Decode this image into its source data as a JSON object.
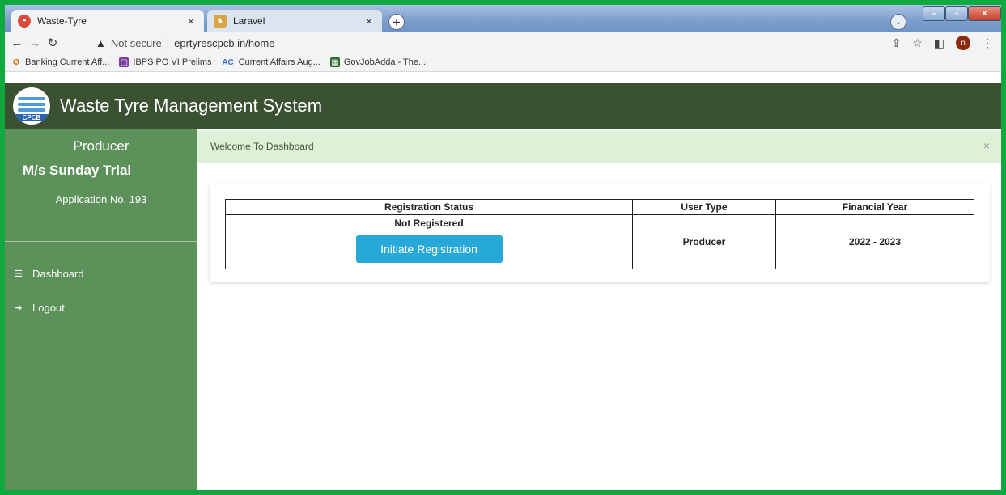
{
  "browser": {
    "tabs": [
      {
        "title": "Waste-Tyre",
        "active": true
      },
      {
        "title": "Laravel",
        "active": false
      }
    ],
    "new_tab": "+",
    "address": {
      "security_label": "Not secure",
      "url": "eprtyrescpcb.in/home"
    },
    "profile_initial": "n",
    "bookmarks": [
      {
        "label": "Banking Current Aff..."
      },
      {
        "label": "IBPS PO VI Prelims"
      },
      {
        "label": "Current Affairs Aug..."
      },
      {
        "label": "GovJobAdda - The..."
      }
    ]
  },
  "app": {
    "title": "Waste Tyre Management System",
    "logo_text": "CPCB"
  },
  "sidebar": {
    "role": "Producer",
    "company": "M/s Sunday Trial",
    "application": "Application No. 193",
    "items": [
      {
        "label": "Dashboard",
        "icon": "dashboard-icon"
      },
      {
        "label": "Logout",
        "icon": "logout-arrow-icon"
      }
    ]
  },
  "main": {
    "alert": "Welcome To Dashboard",
    "table": {
      "headers": [
        "Registration Status",
        "User Type",
        "Financial Year"
      ],
      "row": {
        "status": "Not Registered",
        "button": "Initiate Registration",
        "user_type": "Producer",
        "financial_year": "2022 - 2023"
      }
    }
  },
  "colors": {
    "header_bg": "#3a5232",
    "sidebar_bg": "#5c925a",
    "alert_bg": "#dff0d8",
    "button_bg": "#26a8d8",
    "frame_border": "#0fa93f"
  }
}
